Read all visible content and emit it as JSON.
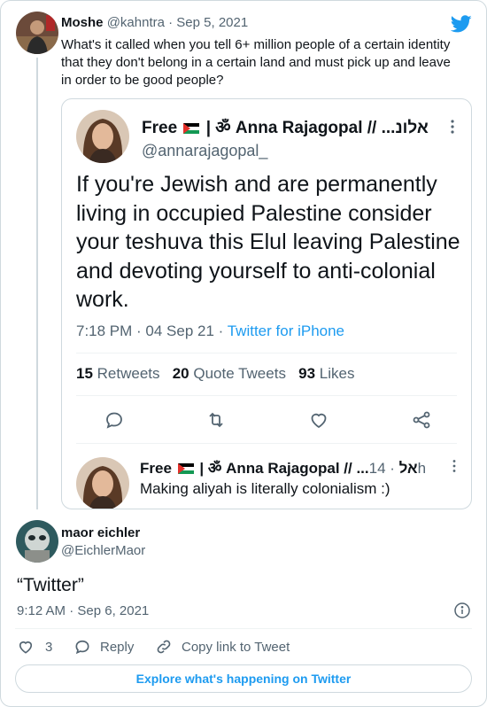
{
  "outer_tweet": {
    "author_name": "Moshe",
    "author_handle": "@kahntra",
    "dot": "·",
    "date": "Sep 5, 2021",
    "text": "What's it called when you tell 6+ million people of a certain identity that they don't belong in a certain land and must pick up and leave in order to be good people?"
  },
  "quoted_tweet": {
    "name_prefix": "Free",
    "name_suffix": "| ॐ Anna Rajagopal // ...אלונ",
    "handle": "@annarajagopal_",
    "text": "If you're Jewish and are permanently living in occupied Palestine consider your teshuva this Elul leaving Palestine and devoting yourself to anti-colonial work.",
    "time": "7:18 PM · 04 Sep 21 · ",
    "client": "Twitter for iPhone",
    "stats": {
      "retweets_count": "15",
      "retweets_label": "Retweets",
      "quotes_count": "20",
      "quotes_label": "Quote Tweets",
      "likes_count": "93",
      "likes_label": "Likes"
    },
    "reply": {
      "name_prefix": "Free",
      "name_suffix": "| ॐ Anna Rajagopal // ...אל",
      "age": "· 14h",
      "text": "Making aliyah is literally colonialism :)"
    }
  },
  "main_tweet": {
    "author_name": "maor eichler",
    "author_handle": "@EichlerMaor",
    "text": "“Twitter”",
    "timestamp": "9:12 AM · Sep 6, 2021"
  },
  "actions": {
    "like_count": "3",
    "reply_label": "Reply",
    "copy_label": "Copy link to Tweet"
  },
  "explore_label": "Explore what's happening on Twitter",
  "colors": {
    "accent": "#1d9bf0",
    "muted": "#536471",
    "border": "#cfd9de"
  }
}
